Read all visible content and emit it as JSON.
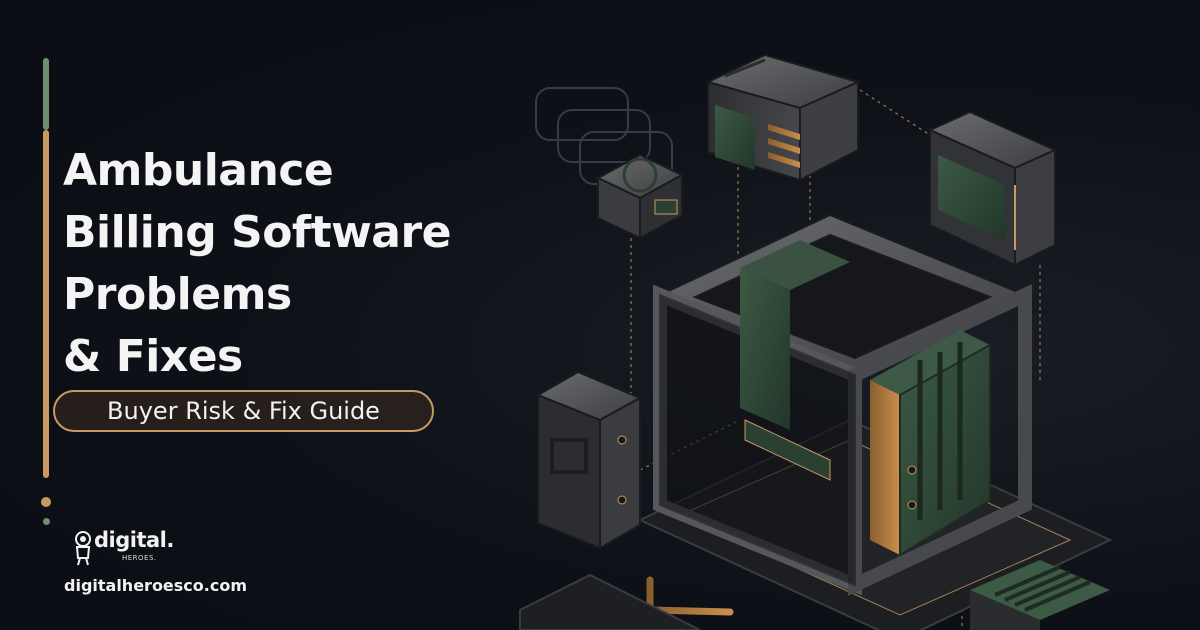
{
  "title_lines": [
    "Ambulance",
    "Billing Software",
    "Problems",
    "& Fixes"
  ],
  "tagline": "Buyer Risk & Fix Guide",
  "brand": {
    "logo_word": "digital.",
    "logo_sub": "HEROES.",
    "logo_icon": "astronaut-icon",
    "url": "digitalheroesco.com"
  },
  "colors": {
    "background": "#0d0f17",
    "accent_gold": "#c79a61",
    "accent_green": "#6f8f6f",
    "text": "#f4f4f4",
    "module_green": "#2f4a37",
    "metal": "#4a4c4f"
  }
}
